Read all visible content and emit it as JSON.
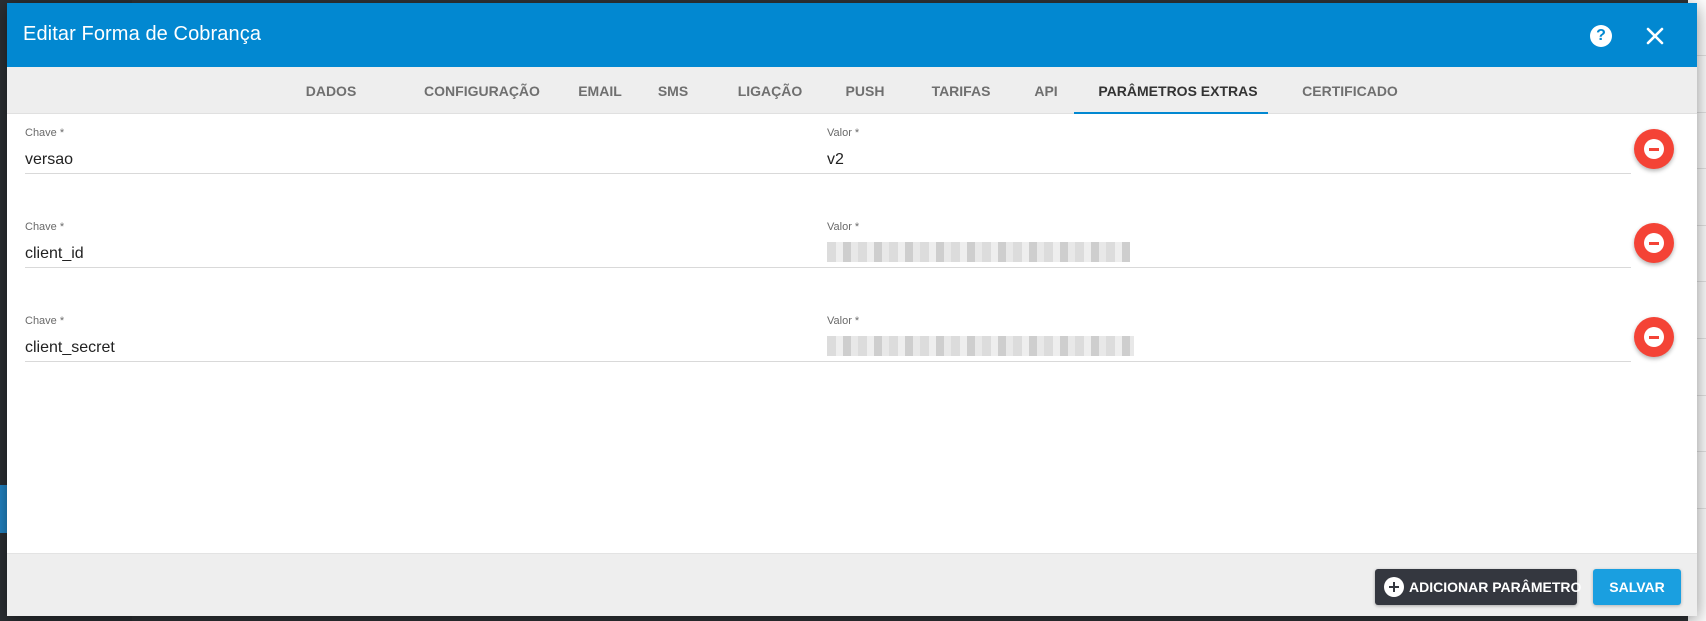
{
  "modal": {
    "title": "Editar Forma de Cobrança"
  },
  "tabs": [
    {
      "label": "DADOS"
    },
    {
      "label": "CONFIGURAÇÃO"
    },
    {
      "label": "EMAIL"
    },
    {
      "label": "SMS"
    },
    {
      "label": "LIGAÇÃO"
    },
    {
      "label": "PUSH"
    },
    {
      "label": "TARIFAS"
    },
    {
      "label": "API"
    },
    {
      "label": "PARÂMETROS EXTRAS",
      "active": true
    },
    {
      "label": "CERTIFICADO"
    }
  ],
  "params": [
    {
      "key_label": "Chave *",
      "key_value": "versao",
      "value_label": "Valor *",
      "value": "v2"
    },
    {
      "key_label": "Chave *",
      "key_value": "client_id",
      "value_label": "Valor *",
      "value": ""
    },
    {
      "key_label": "Chave *",
      "key_value": "client_secret",
      "value_label": "Valor *",
      "value": ""
    }
  ],
  "footer": {
    "add_param_label": "ADICIONAR PARÂMETRO",
    "save_label": "SALVAR"
  },
  "colors": {
    "header": "#0288d1",
    "remove": "#f44336",
    "save": "#1a9fe0",
    "add_param": "#34373f"
  }
}
